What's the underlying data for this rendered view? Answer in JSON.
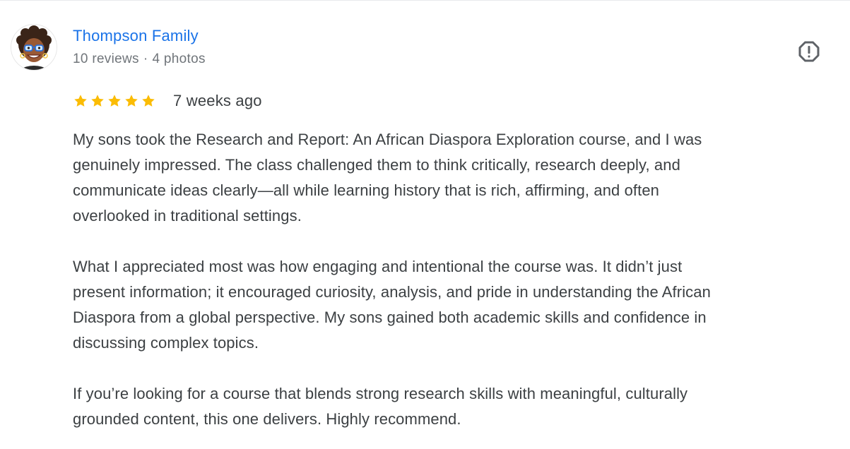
{
  "review": {
    "author_name": "Thompson Family",
    "reviews_count": "10 reviews",
    "separator": "·",
    "photos_count": "4 photos",
    "rating": 5,
    "max_rating": 5,
    "time_ago": "7 weeks ago",
    "paragraphs": [
      "My sons took the Research and Report: An African Diaspora Exploration course, and I was\ngenuinely impressed. The class challenged them to think critically, research deeply, and\ncommunicate ideas clearly—all while learning history that is rich, affirming, and often\noverlooked in traditional settings.",
      "What I appreciated most was how engaging and intentional the course was. It didn’t just\npresent information; it encouraged curiosity, analysis, and pride in understanding the African\nDiaspora from a global perspective. My sons gained both academic skills and confidence in\ndiscussing complex topics.",
      "If you’re looking for a course that blends strong research skills with meaningful, culturally\ngrounded content, this one delivers. Highly recommend."
    ]
  },
  "icons": {
    "report": "report-flag-icon",
    "star": "star-icon"
  },
  "colors": {
    "author_link": "#1a73e8",
    "star_filled": "#fbbc04",
    "meta_text": "#70757a",
    "body_text": "#3c4043"
  }
}
